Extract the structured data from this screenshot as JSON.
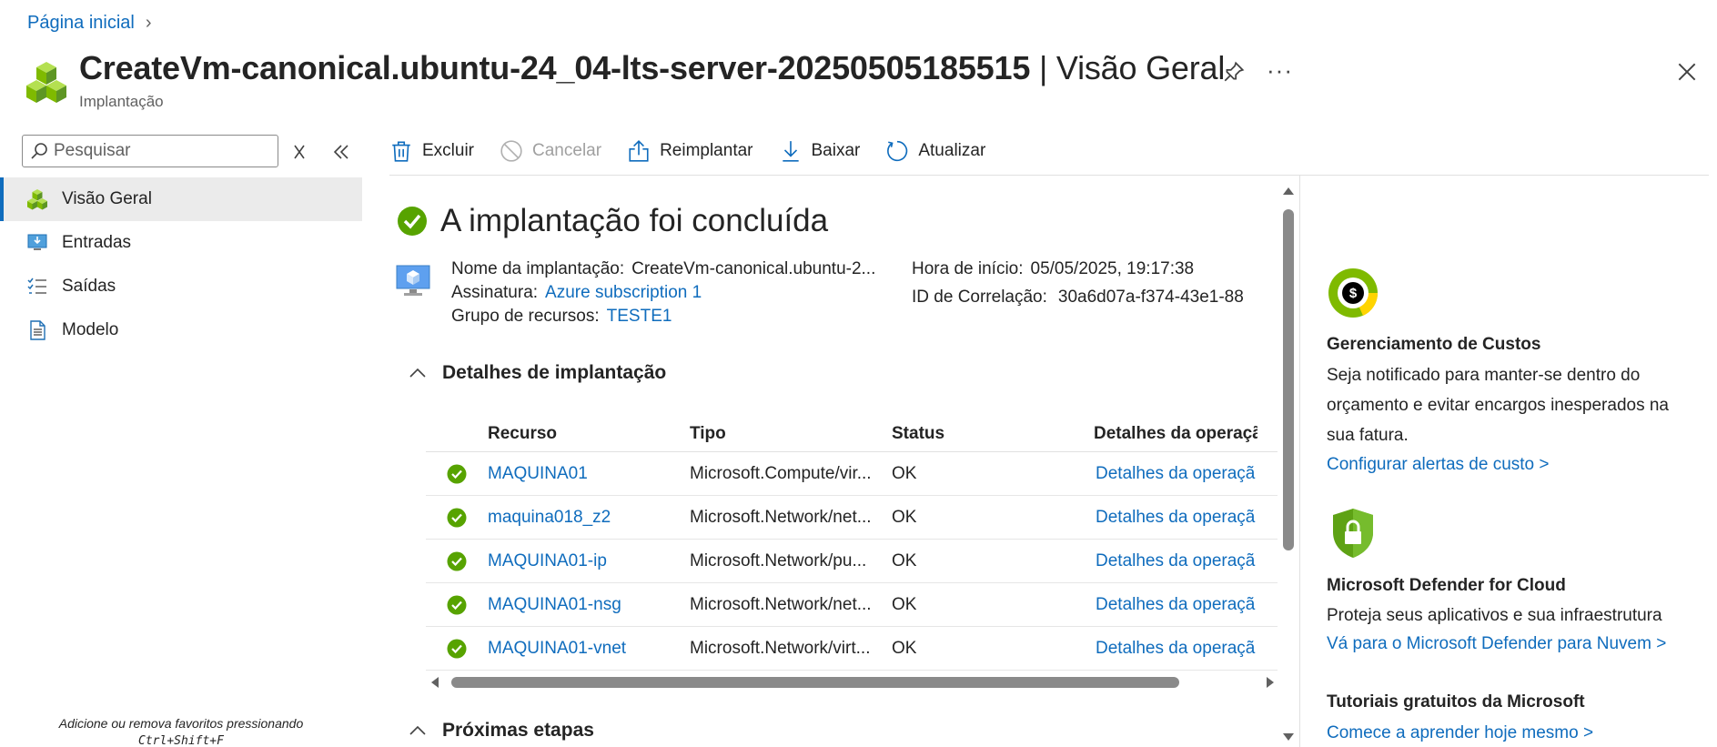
{
  "breadcrumb": {
    "home": "Página inicial"
  },
  "header": {
    "title": "CreateVm-canonical.ubuntu-24_04-lts-server-20250505185515",
    "separator": " | ",
    "title_suffix": "Visão Geral",
    "subtitle": "Implantação",
    "more_label": "···"
  },
  "sidebar": {
    "search_placeholder": "Pesquisar",
    "items": [
      {
        "label": "Visão Geral",
        "icon": "cubes-icon",
        "active": true
      },
      {
        "label": "Entradas",
        "icon": "monitor-download-icon"
      },
      {
        "label": "Saídas",
        "icon": "checklist-icon"
      },
      {
        "label": "Modelo",
        "icon": "document-icon"
      }
    ],
    "favorites_hint_line1": "Adicione ou remova favoritos pressionando",
    "favorites_hint_line2": "Ctrl+Shift+F"
  },
  "toolbar": {
    "delete": "Excluir",
    "cancel": "Cancelar",
    "redeploy": "Reimplantar",
    "download": "Baixar",
    "refresh": "Atualizar"
  },
  "main": {
    "status_title": "A implantação foi concluída",
    "info": {
      "deployment_name_label": "Nome da implantação:",
      "deployment_name": "CreateVm-canonical.ubuntu-2...",
      "subscription_label": "Assinatura:",
      "subscription": "Azure subscription 1",
      "resource_group_label": "Grupo de recursos:",
      "resource_group": "TESTE1",
      "start_time_label": "Hora de início:",
      "start_time": "05/05/2025, 19:17:38",
      "correlation_label": "ID de Correlação:",
      "correlation_id": "30a6d07a-f374-43e1-88"
    },
    "details_section": "Detalhes de implantação",
    "next_steps_section": "Próximas etapas",
    "table": {
      "headers": [
        "Recurso",
        "Tipo",
        "Status",
        "Detalhes da operaçã"
      ],
      "rows": [
        {
          "resource": "MAQUINA01",
          "type": "Microsoft.Compute/vir...",
          "status": "OK",
          "details": "Detalhes da operaçã"
        },
        {
          "resource": "maquina018_z2",
          "type": "Microsoft.Network/net...",
          "status": "OK",
          "details": "Detalhes da operaçã"
        },
        {
          "resource": "MAQUINA01-ip",
          "type": "Microsoft.Network/pu...",
          "status": "OK",
          "details": "Detalhes da operaçã"
        },
        {
          "resource": "MAQUINA01-nsg",
          "type": "Microsoft.Network/net...",
          "status": "OK",
          "details": "Detalhes da operaçã"
        },
        {
          "resource": "MAQUINA01-vnet",
          "type": "Microsoft.Network/virt...",
          "status": "OK",
          "details": "Detalhes da operaçã"
        }
      ]
    }
  },
  "right_panel": {
    "cost": {
      "title": "Gerenciamento de Custos",
      "line1": "Seja notificado para manter-se dentro do",
      "line2": "orçamento e evitar encargos inesperados na",
      "line3": "sua fatura.",
      "link": "Configurar alertas de custo >"
    },
    "defender": {
      "title": "Microsoft Defender for Cloud",
      "text": "Proteja seus aplicativos e sua infraestrutura",
      "link": "Vá para o Microsoft Defender para Nuvem >"
    },
    "tutorials": {
      "title": "Tutoriais gratuitos da Microsoft",
      "link": "Comece a aprender hoje mesmo >"
    }
  },
  "colors": {
    "accent": "#0f6cbd",
    "success": "#57a300",
    "cube_green": "#7fba00"
  }
}
